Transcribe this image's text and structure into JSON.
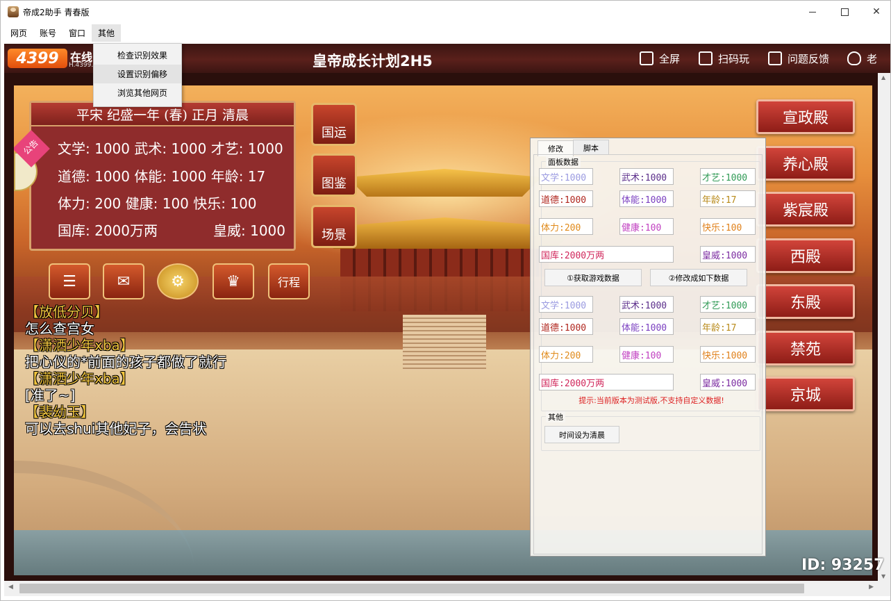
{
  "window": {
    "title": "帝成2助手 青春版"
  },
  "menu": [
    {
      "label": "网页"
    },
    {
      "label": "账号"
    },
    {
      "label": "窗口"
    },
    {
      "label": "其他"
    }
  ],
  "dropdown": {
    "items": [
      "检查识别效果",
      "设置识别偏移",
      "浏览其他网页"
    ]
  },
  "game_header": {
    "logo": "4399",
    "logo_sub": "在线",
    "logo_url": "H.4399.",
    "title": "皇帝成长计划2H5",
    "buttons": [
      "全屏",
      "扫码玩",
      "问题反馈",
      "老"
    ]
  },
  "status_panel": {
    "date": "平宋 纪盛一年 (春) 正月 清晨",
    "line1": "文学: 1000 武术: 1000 才艺: 1000",
    "line2": "道德: 1000 体能: 1000 年龄: 17",
    "line3": "体力: 200   健康: 100   快乐: 100",
    "line4a": "国库: 2000万两",
    "line4b": "皇威: 1000",
    "notice": "公告"
  },
  "side_icons": [
    "国运",
    "图鉴",
    "场景"
  ],
  "tool_icons": {
    "schedule": "行程"
  },
  "chat": [
    {
      "type": "nm",
      "text": "【放低分贝】"
    },
    {
      "type": "msg",
      "text": "怎么查宫女"
    },
    {
      "type": "nm",
      "text": "【潇洒少年xba】"
    },
    {
      "type": "msg",
      "text": "把心仪的*前面的孩子都做了就行"
    },
    {
      "type": "nm",
      "text": "【潇洒少年xba】"
    },
    {
      "type": "msg",
      "text": "[准了~]"
    },
    {
      "type": "nm",
      "text": "【裴幼玉】"
    },
    {
      "type": "msg",
      "text": "可以去shui其他妃子，会告状"
    }
  ],
  "palace_buttons": [
    "宣政殿",
    "养心殿",
    "紫宸殿",
    "西殿",
    "东殿",
    "禁苑",
    "京城"
  ],
  "id_tag": "ID: 93257",
  "tool_panel": {
    "tabs": [
      "修改",
      "脚本"
    ],
    "group_panel": "面板数据",
    "group_other": "其他",
    "top_fields": {
      "wenxue": "文学:1000",
      "wushu": "武术:1000",
      "caiyi": "才艺:1000",
      "daode": "道德:1000",
      "tineng": "体能:1000",
      "nianling": "年龄:17",
      "tili": "体力:200",
      "jiankang": "健康:100",
      "kuaile": "快乐:100",
      "guoku": "国库:2000万两",
      "huangwei": "皇威:1000"
    },
    "btn_get": "①获取游戏数据",
    "btn_set": "②修改成如下数据",
    "bottom_fields": {
      "wenxue": "文学:1000",
      "wushu": "武术:1000",
      "caiyi": "才艺:1000",
      "daode": "道德:1000",
      "tineng": "体能:1000",
      "nianling": "年龄:17",
      "tili": "体力:200",
      "jiankang": "健康:100",
      "kuaile": "快乐:1000",
      "guoku": "国库:2000万两",
      "huangwei": "皇威:1000"
    },
    "warning": "提示:当前版本为测试版,不支持自定义数据!",
    "btn_morning": "时间设为清晨"
  },
  "colors": {
    "wenxue": "#9a9ae0",
    "wushu": "#5a2d8a",
    "caiyi": "#2f9a55",
    "daode": "#b0261e",
    "tineng": "#7a3fc0",
    "nianling": "#b88a1a",
    "tili": "#e08a1a",
    "jiankang": "#c03fc0",
    "kuaile": "#e0801a",
    "guoku": "#d0255a",
    "huangwei": "#7a2aa0"
  }
}
